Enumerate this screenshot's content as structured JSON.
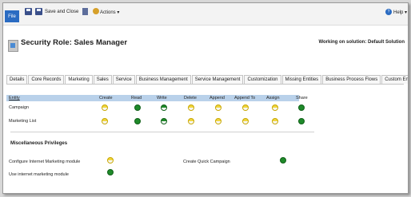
{
  "ribbon": {
    "file_label": "File",
    "save_and_close_label": "Save and Close",
    "actions_label": "Actions ▾",
    "help_label": "Help ▾"
  },
  "header": {
    "title": "Security Role: Sales Manager",
    "solution_text": "Working on solution: Default Solution"
  },
  "tabs": [
    {
      "label": "Details"
    },
    {
      "label": "Core Records"
    },
    {
      "label": "Marketing"
    },
    {
      "label": "Sales"
    },
    {
      "label": "Service"
    },
    {
      "label": "Business Management"
    },
    {
      "label": "Service Management"
    },
    {
      "label": "Customization"
    },
    {
      "label": "Missing Entities"
    },
    {
      "label": "Business Process Flows"
    },
    {
      "label": "Custom Entities"
    }
  ],
  "grid": {
    "columns": [
      "Entity",
      "Create",
      "Read",
      "Write",
      "Delete",
      "Append",
      "Append To",
      "Assign",
      "Share"
    ],
    "rows": [
      {
        "entity": "Campaign",
        "levels": [
          "yellow",
          "green",
          "green-half",
          "yellow",
          "yellow",
          "yellow",
          "yellow",
          "green"
        ]
      },
      {
        "entity": "Marketing List",
        "levels": [
          "yellow",
          "green",
          "green-half",
          "yellow",
          "yellow",
          "yellow",
          "yellow",
          "green"
        ]
      }
    ]
  },
  "misc": {
    "heading": "Miscellaneous Privileges",
    "items": [
      {
        "label": "Configure Internet Marketing module",
        "level": "yellow"
      },
      {
        "label": "Use internet marketing module",
        "level": "green"
      },
      {
        "label": "Create Quick Campaign",
        "level": "green"
      }
    ]
  },
  "colors": {
    "file_button": "#2a6bc2",
    "grid_header": "#b9d1ea",
    "level_user": "#f0d640",
    "level_org": "#1f8a2a"
  }
}
